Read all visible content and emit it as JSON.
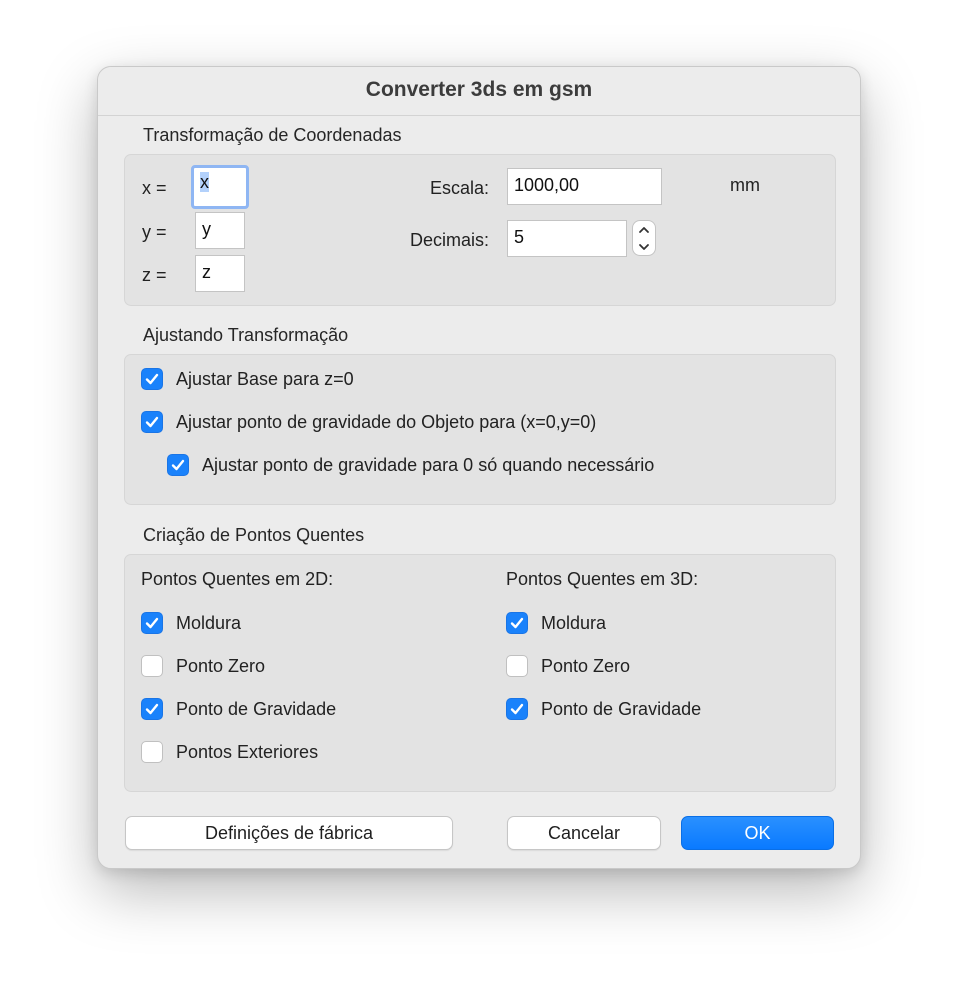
{
  "dialog": {
    "title": "Converter 3ds em gsm"
  },
  "coordinates": {
    "section_label": "Transformação de Coordenadas",
    "x_label": "x =",
    "x_value": "x",
    "y_label": "y =",
    "y_value": "y",
    "z_label": "z =",
    "z_value": "z",
    "scale_label": "Escala:",
    "scale_value": "1000,00",
    "scale_unit": "mm",
    "decimals_label": "Decimais:",
    "decimals_value": "5"
  },
  "adjust": {
    "section_label": "Ajustando Transformação",
    "items": [
      {
        "label": "Ajustar Base para z=0",
        "checked": true
      },
      {
        "label": "Ajustar ponto de gravidade do Objeto para (x=0,y=0)",
        "checked": true
      },
      {
        "label": "Ajustar ponto de gravidade para 0 só quando necessário",
        "checked": true
      }
    ]
  },
  "hotspots": {
    "section_label": "Criação de Pontos Quentes",
    "col2d": {
      "heading": "Pontos Quentes em 2D:",
      "items": [
        {
          "label": "Moldura",
          "checked": true
        },
        {
          "label": "Ponto Zero",
          "checked": false
        },
        {
          "label": "Ponto de Gravidade",
          "checked": true
        },
        {
          "label": "Pontos Exteriores",
          "checked": false
        }
      ]
    },
    "col3d": {
      "heading": "Pontos Quentes em 3D:",
      "items": [
        {
          "label": "Moldura",
          "checked": true
        },
        {
          "label": "Ponto Zero",
          "checked": false
        },
        {
          "label": "Ponto de Gravidade",
          "checked": true
        }
      ]
    }
  },
  "buttons": {
    "defaults": "Definições de fábrica",
    "cancel": "Cancelar",
    "ok": "OK"
  },
  "colors": {
    "accent": "#1a82fb",
    "dialog_bg": "#ececec",
    "panel_bg": "#e3e3e3"
  }
}
